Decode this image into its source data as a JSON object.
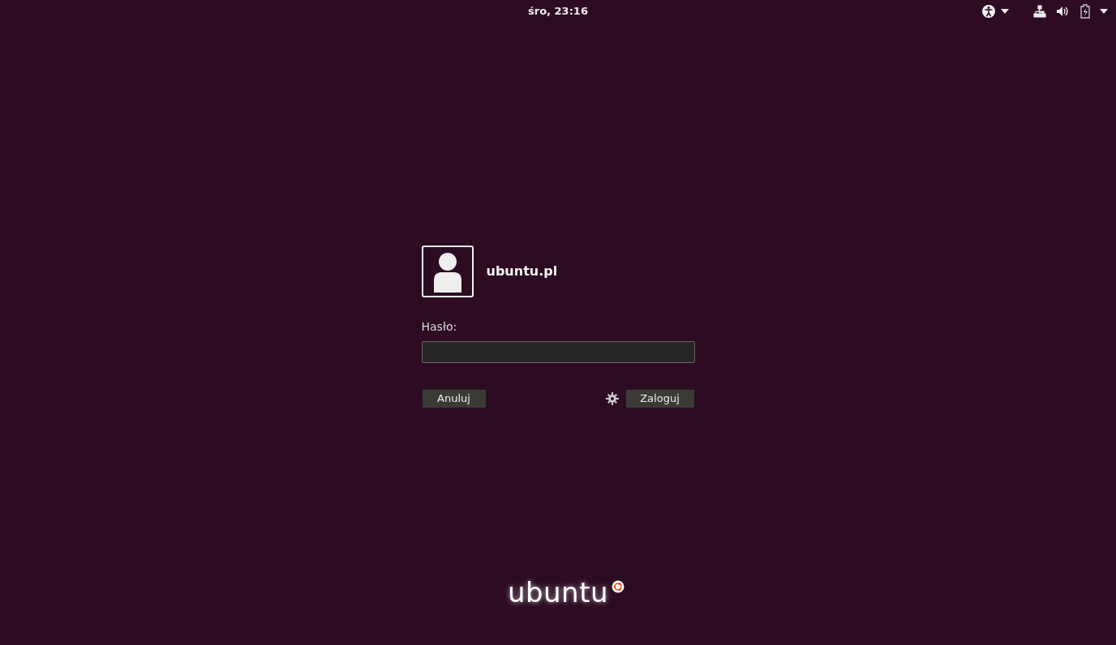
{
  "top_bar": {
    "clock": "śro, 23:16"
  },
  "login": {
    "username": "ubuntu.pl",
    "password_label": "Hasło:",
    "cancel_button": "Anuluj",
    "login_button": "Zaloguj"
  },
  "logo": {
    "text": "ubuntu"
  }
}
